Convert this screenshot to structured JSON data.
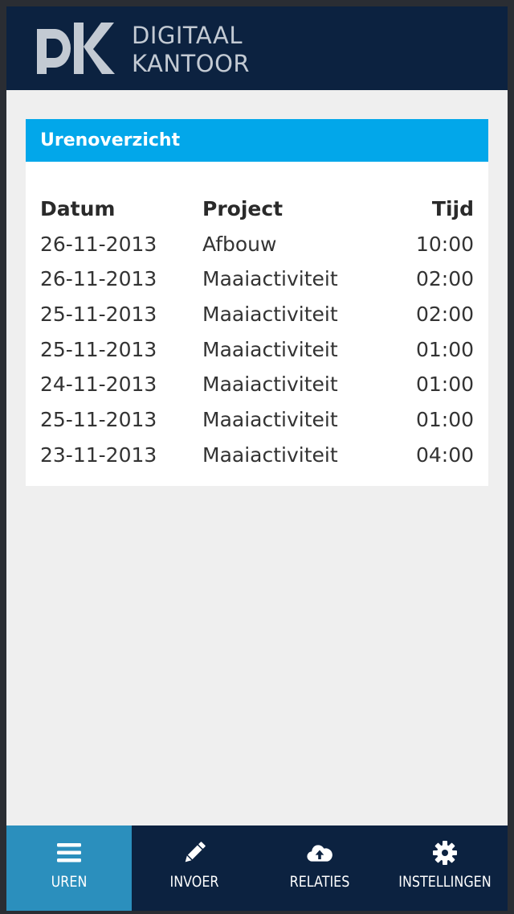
{
  "header": {
    "brand_line1": "DIGITAAL",
    "brand_line2": "KANTOOR",
    "logo_icon": "dk-logo"
  },
  "card": {
    "title": "Urenoverzicht",
    "columns": [
      "Datum",
      "Project",
      "Tijd"
    ],
    "rows": [
      {
        "date": "26-11-2013",
        "project": "Afbouw",
        "time": "10:00"
      },
      {
        "date": "26-11-2013",
        "project": "Maaiactiviteit",
        "time": "02:00"
      },
      {
        "date": "25-11-2013",
        "project": "Maaiactiviteit",
        "time": "02:00"
      },
      {
        "date": "25-11-2013",
        "project": "Maaiactiviteit",
        "time": "01:00"
      },
      {
        "date": "24-11-2013",
        "project": "Maaiactiviteit",
        "time": "01:00"
      },
      {
        "date": "25-11-2013",
        "project": "Maaiactiviteit",
        "time": "01:00"
      },
      {
        "date": "23-11-2013",
        "project": "Maaiactiviteit",
        "time": "04:00"
      }
    ]
  },
  "tabs": [
    {
      "label": "UREN",
      "icon": "menu-icon",
      "active": true
    },
    {
      "label": "INVOER",
      "icon": "pencil-icon",
      "active": false
    },
    {
      "label": "RELATIES",
      "icon": "cloud-upload-icon",
      "active": false
    },
    {
      "label": "INSTELLINGEN",
      "icon": "gear-icon",
      "active": false
    }
  ],
  "colors": {
    "header_bg": "#0c2240",
    "accent": "#02a7ea",
    "active_tab": "#2b8fbd",
    "page_bg": "#efefef"
  }
}
